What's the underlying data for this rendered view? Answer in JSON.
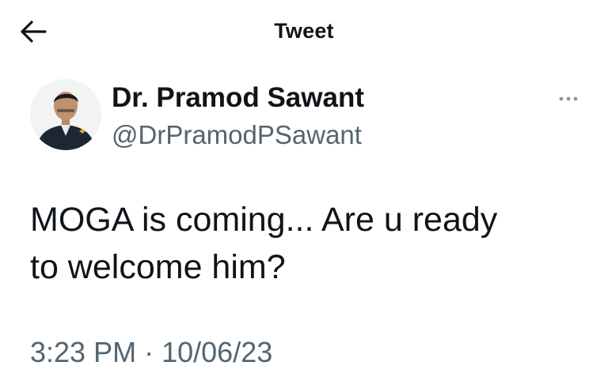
{
  "header": {
    "title": "Tweet",
    "back_icon": "arrow-left-icon"
  },
  "tweet": {
    "author": {
      "display_name": "Dr. Pramod Sawant",
      "handle": "@DrPramodPSawant"
    },
    "more_icon": "more-horizontal-icon",
    "text_line_1": "MOGA is coming... Are u ready",
    "text_line_2": "to welcome him?",
    "time": "3:23 PM",
    "separator": "·",
    "date": "10/06/23"
  },
  "colors": {
    "text_primary": "#0f1419",
    "text_secondary": "#536471",
    "background": "#ffffff"
  }
}
